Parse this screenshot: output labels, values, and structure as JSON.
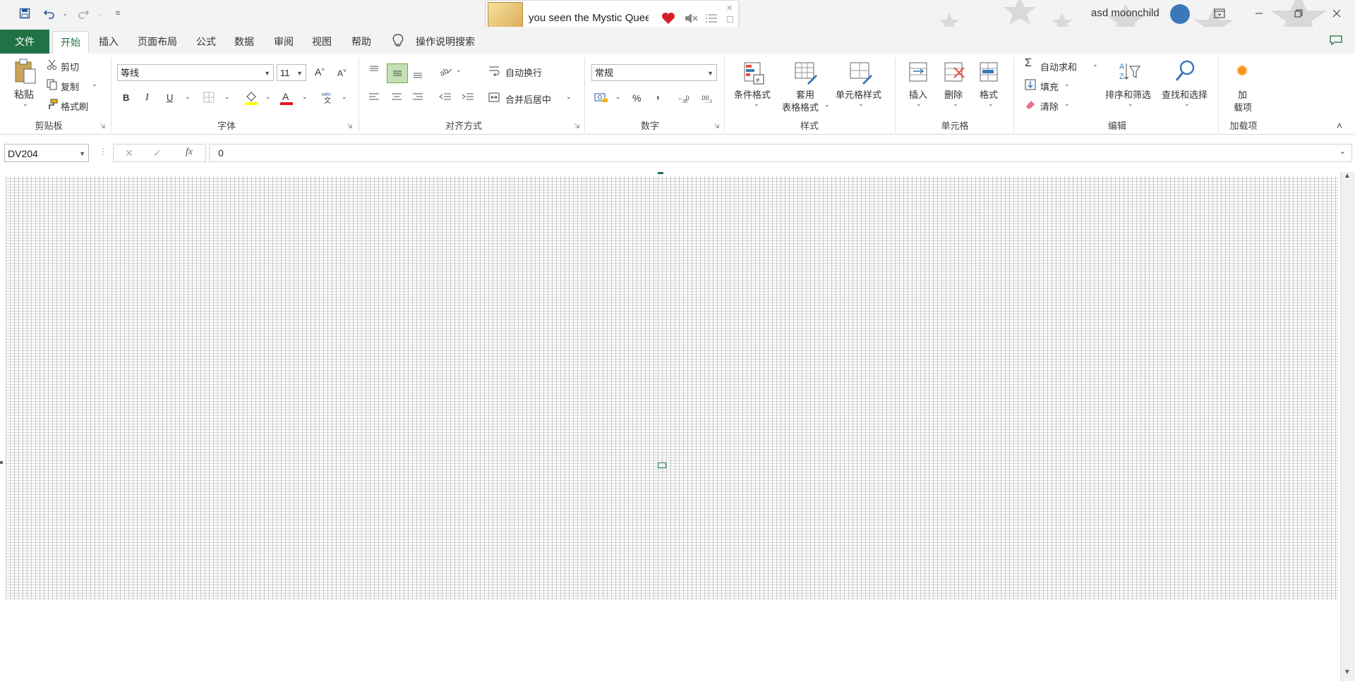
{
  "titlebar": {
    "user_name": "asd moonchild",
    "qat_icons": [
      "save-icon",
      "undo-icon",
      "redo-icon",
      "customize-icon"
    ]
  },
  "music_popup": {
    "title": "you seen the Mystic Quee"
  },
  "tabs": [
    "文件",
    "开始",
    "插入",
    "页面布局",
    "公式",
    "数据",
    "审阅",
    "视图",
    "帮助"
  ],
  "tell_me": "操作说明搜索",
  "ribbon": {
    "clipboard": {
      "paste": "粘贴",
      "cut": "剪切",
      "copy": "复制",
      "format_painter": "格式刷",
      "label": "剪贴板"
    },
    "font": {
      "font_name": "等线",
      "font_size": "11",
      "bold": "B",
      "italic": "I",
      "underline": "U",
      "label": "字体"
    },
    "alignment": {
      "wrap": "自动换行",
      "merge": "合并后居中",
      "label": "对齐方式"
    },
    "number": {
      "format": "常规",
      "percent": "%",
      "comma": ",",
      "label": "数字"
    },
    "styles": {
      "conditional": "条件格式",
      "table_line1": "套用",
      "table_line2": "表格格式",
      "cell_styles": "单元格样式",
      "label": "样式"
    },
    "cells": {
      "insert": "插入",
      "delete": "删除",
      "format": "格式",
      "label": "单元格"
    },
    "editing": {
      "autosum": "自动求和",
      "fill": "填充",
      "clear": "清除",
      "sort": "排序和筛选",
      "find": "查找和选择",
      "label": "编辑"
    },
    "addins": {
      "btn_line1": "加",
      "btn_line2": "载项",
      "label": "加载项"
    }
  },
  "formula_bar": {
    "name_box": "DV204",
    "value": "0",
    "fx": "fx"
  },
  "colors": {
    "excel_green": "#217346",
    "fill_yellow": "#ffff00",
    "font_red": "#e81123"
  }
}
